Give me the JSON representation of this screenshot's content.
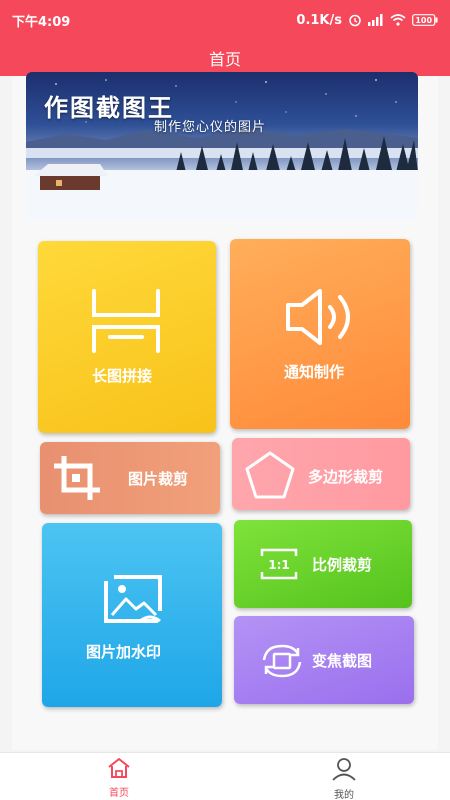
{
  "status_bar": {
    "time": "下午4:09",
    "net_speed": "0.1K/s",
    "battery": "100"
  },
  "header": {
    "title": "首页"
  },
  "banner": {
    "title": "作图截图王",
    "subtitle": "制作您心仪的图片"
  },
  "tiles": {
    "long_stitch": {
      "label": "长图拼接",
      "icon": "long-image-icon"
    },
    "notify": {
      "label": "通知制作",
      "icon": "speaker-icon"
    },
    "crop": {
      "label": "图片裁剪",
      "icon": "crop-icon"
    },
    "polygon": {
      "label": "多边形裁剪",
      "icon": "pentagon-icon"
    },
    "watermark": {
      "label": "图片加水印",
      "icon": "image-icon"
    },
    "ratio": {
      "label": "比例裁剪",
      "icon": "ratio-icon",
      "ratio_text": "1:1"
    },
    "zoom": {
      "label": "变焦截图",
      "icon": "rotate-screenshot-icon"
    }
  },
  "bottom_nav": {
    "home": {
      "label": "首页",
      "active": true
    },
    "mine": {
      "label": "我的",
      "active": false
    }
  },
  "colors": {
    "accent": "#f5495b",
    "long_stitch": "#f8c21a",
    "notify": "#ff8a3a",
    "crop": "#ec9473",
    "polygon": "#ffa0a6",
    "watermark": "#1fa6e8",
    "ratio": "#62c925",
    "zoom": "#a57ff0"
  }
}
